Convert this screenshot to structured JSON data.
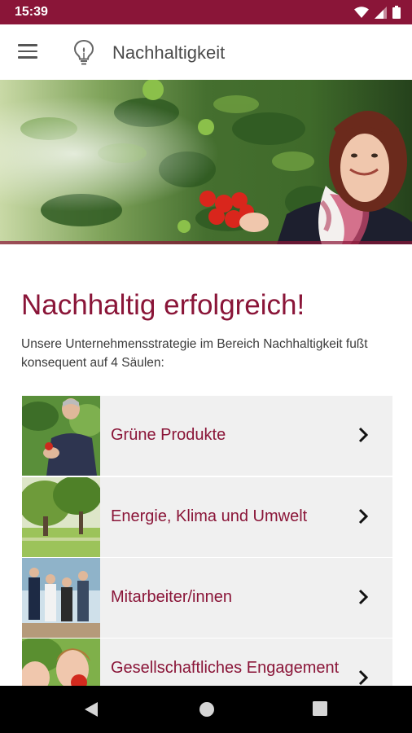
{
  "status_bar": {
    "time": "15:39",
    "background_color": "#8a1538"
  },
  "app_bar": {
    "title": "Nachhaltigkeit",
    "menu_icon": "hamburger-menu-icon",
    "logo_icon": "lightbulb-icon"
  },
  "hero": {
    "description_icon": "hero-image"
  },
  "content": {
    "heading": "Nachhaltig erfolgreich!",
    "intro": "Unsere Unternehmensstrategie im Bereich Nachhaltigkeit fußt konsequent auf 4 Säulen:",
    "accent_color": "#8a1538"
  },
  "pillars": [
    {
      "label": "Grüne Produkte",
      "icon": "chevron-right-icon"
    },
    {
      "label": "Energie, Klima und Umwelt",
      "icon": "chevron-right-icon"
    },
    {
      "label": "Mitarbeiter/innen",
      "icon": "chevron-right-icon"
    },
    {
      "label": "Gesellschaftliches Engagement",
      "icon": "chevron-right-icon"
    }
  ],
  "nav_bar": {
    "back_icon": "back-triangle-icon",
    "home_icon": "home-circle-icon",
    "recents_icon": "recents-square-icon"
  }
}
